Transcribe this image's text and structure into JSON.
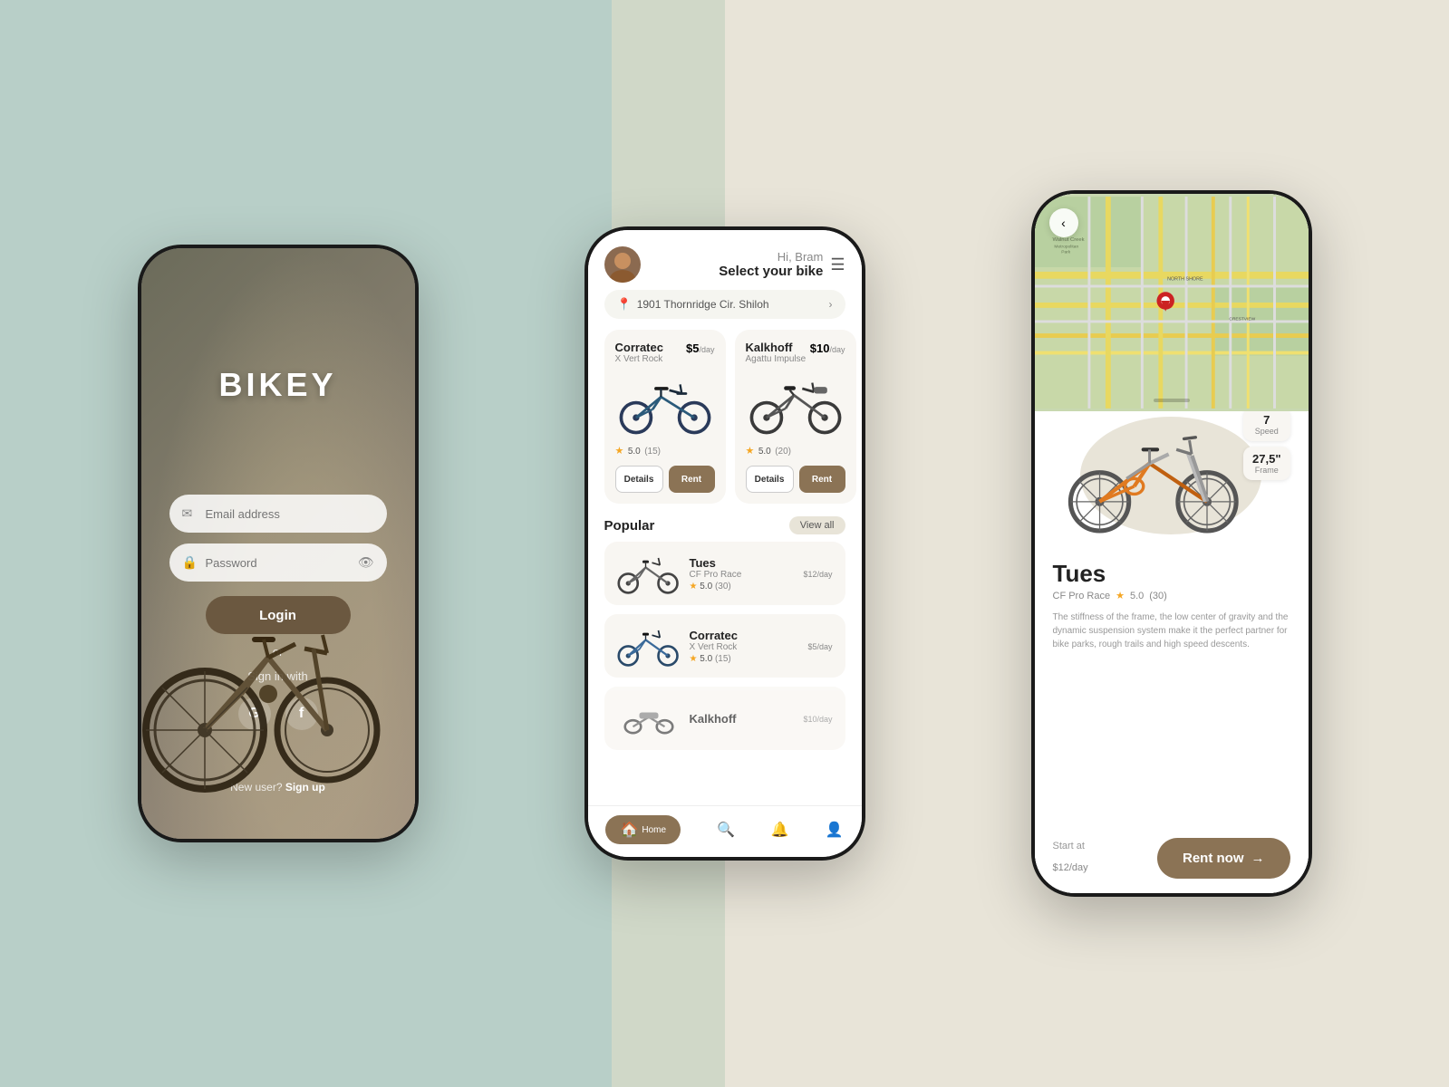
{
  "app": {
    "name": "BIKEY"
  },
  "phone1": {
    "title": "BIKEY",
    "email_placeholder": "Email address",
    "password_placeholder": "Password",
    "login_btn": "Login",
    "or_text": "or",
    "signin_with": "Sign in with",
    "new_user": "New user?",
    "signup_link": "Sign up"
  },
  "phone2": {
    "greeting_hi": "Hi, Bram",
    "greeting_select": "Select your bike",
    "location": "1901 Thornridge Cir. Shiloh",
    "cards": [
      {
        "brand": "Corratec",
        "model": "X Vert Rock",
        "price": "$5",
        "price_unit": "/day",
        "rating": "5.0",
        "reviews": "(15)",
        "details_btn": "Details",
        "rent_btn": "Rent"
      },
      {
        "brand": "Kalkhoff",
        "model": "Agattu Impulse",
        "price": "$10",
        "price_unit": "/day",
        "rating": "5.0",
        "reviews": "(20)",
        "details_btn": "Details",
        "rent_btn": "Rent"
      }
    ],
    "popular_title": "Popular",
    "view_all": "View all",
    "popular_items": [
      {
        "brand": "Tues",
        "model": "CF Pro Race",
        "price": "$12",
        "price_unit": "/day",
        "rating": "5.0",
        "reviews": "(30)"
      },
      {
        "brand": "Corratec",
        "model": "X Vert Rock",
        "price": "$5",
        "price_unit": "/day",
        "rating": "5.0",
        "reviews": "(15)"
      },
      {
        "brand": "Kalkhoff",
        "model": "",
        "price": "$10",
        "price_unit": "/day",
        "rating": "",
        "reviews": ""
      }
    ],
    "nav": {
      "home": "Home",
      "search": "Search",
      "bell": "Notifications",
      "profile": "Profile"
    }
  },
  "phone3": {
    "bike_name": "Tues",
    "bike_model": "CF Pro Race",
    "bike_rating": "5.0",
    "bike_reviews": "(30)",
    "bike_description": "The stiffness of the frame, the low center of gravity and the dynamic suspension system make it the perfect partner for bike parks, rough trails and high speed descents.",
    "spec_speed_label": "Speed",
    "spec_speed_val": "7",
    "spec_frame_label": "Frame",
    "spec_frame_val": "27,5\"",
    "start_at": "Start at",
    "price": "$12",
    "price_unit": "/day",
    "rent_btn": "Rent now"
  },
  "colors": {
    "bg_left": "#b8cfc8",
    "bg_right": "#e8e4d8",
    "accent_brown": "#8b7355",
    "star": "#f5a623",
    "map_pin": "#cc2222"
  }
}
